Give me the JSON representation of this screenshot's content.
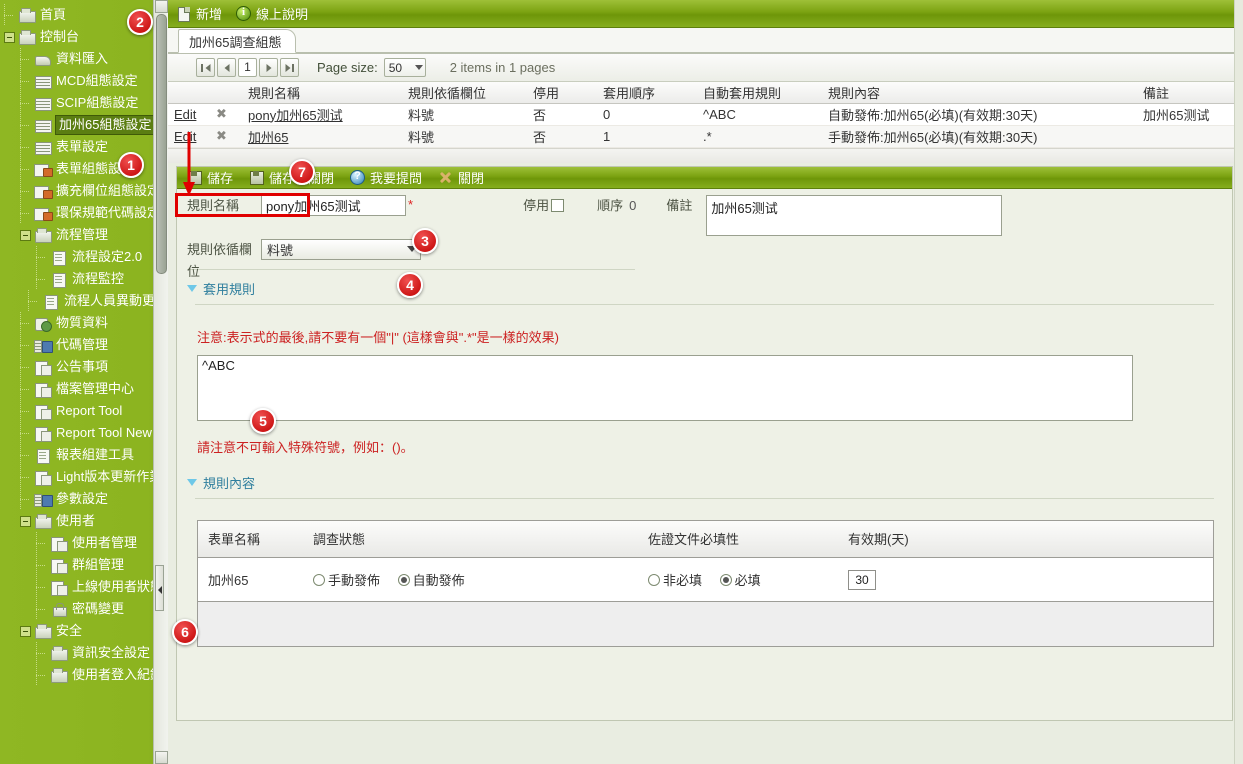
{
  "sidebar": {
    "items": [
      {
        "label": "首頁",
        "level": 0,
        "icon": "folder-icon",
        "expander": false,
        "selected": false
      },
      {
        "label": "控制台",
        "level": 0,
        "icon": "folder-icon",
        "expander": true,
        "selected": false
      },
      {
        "label": "資料匯入",
        "level": 1,
        "icon": "import-icon",
        "expander": false,
        "selected": false
      },
      {
        "label": "MCD組態設定",
        "level": 1,
        "icon": "grid-icon",
        "expander": false,
        "selected": false
      },
      {
        "label": "SCIP組態設定",
        "level": 1,
        "icon": "grid-icon",
        "expander": false,
        "selected": false
      },
      {
        "label": "加州65組態設定",
        "level": 1,
        "icon": "grid-icon",
        "expander": false,
        "selected": true
      },
      {
        "label": "表單設定",
        "level": 1,
        "icon": "grid-icon",
        "expander": false,
        "selected": false
      },
      {
        "label": "表單組態設定",
        "level": 1,
        "icon": "gridp-icon",
        "expander": false,
        "selected": false
      },
      {
        "label": "擴充欄位組態設定",
        "level": 1,
        "icon": "gridp-icon",
        "expander": false,
        "selected": false
      },
      {
        "label": "環保規範代碼設定",
        "level": 1,
        "icon": "gridp-icon",
        "expander": false,
        "selected": false
      },
      {
        "label": "流程管理",
        "level": 1,
        "icon": "folder-icon",
        "expander": true,
        "selected": false
      },
      {
        "label": "流程設定2.0",
        "level": 2,
        "icon": "doc-icon",
        "expander": false,
        "selected": false
      },
      {
        "label": "流程監控",
        "level": 2,
        "icon": "doc-icon",
        "expander": false,
        "selected": false
      },
      {
        "label": "流程人員異動更新",
        "level": 2,
        "icon": "doc-icon",
        "expander": false,
        "selected": false
      },
      {
        "label": "物質資料",
        "level": 1,
        "icon": "material-icon",
        "expander": false,
        "selected": false
      },
      {
        "label": "代碼管理",
        "level": 1,
        "icon": "code-icon",
        "expander": false,
        "selected": false
      },
      {
        "label": "公告事項",
        "level": 1,
        "icon": "page-icon",
        "expander": false,
        "selected": false
      },
      {
        "label": "檔案管理中心",
        "level": 1,
        "icon": "page-icon",
        "expander": false,
        "selected": false
      },
      {
        "label": "Report Tool",
        "level": 1,
        "icon": "page-icon",
        "expander": false,
        "selected": false
      },
      {
        "label": "Report Tool New",
        "level": 1,
        "icon": "page-icon",
        "expander": false,
        "selected": false
      },
      {
        "label": "報表組建工具",
        "level": 1,
        "icon": "doc-icon",
        "expander": false,
        "selected": false
      },
      {
        "label": "Light版本更新作業",
        "level": 1,
        "icon": "page-icon",
        "expander": false,
        "selected": false
      },
      {
        "label": "參數設定",
        "level": 1,
        "icon": "code-icon",
        "expander": false,
        "selected": false
      },
      {
        "label": "使用者",
        "level": 1,
        "icon": "folder-icon",
        "expander": true,
        "selected": false
      },
      {
        "label": "使用者管理",
        "level": 2,
        "icon": "page-icon",
        "expander": false,
        "selected": false
      },
      {
        "label": "群組管理",
        "level": 2,
        "icon": "page-icon",
        "expander": false,
        "selected": false
      },
      {
        "label": "上線使用者狀態",
        "level": 2,
        "icon": "page-icon",
        "expander": false,
        "selected": false
      },
      {
        "label": "密碼變更",
        "level": 2,
        "icon": "lock-icon",
        "expander": false,
        "selected": false
      },
      {
        "label": "安全",
        "level": 1,
        "icon": "folder-icon",
        "expander": true,
        "selected": false
      },
      {
        "label": "資訊安全設定",
        "level": 2,
        "icon": "folder-icon",
        "expander": false,
        "selected": false
      },
      {
        "label": "使用者登入紀錄",
        "level": 2,
        "icon": "folder-icon",
        "expander": false,
        "selected": false
      }
    ]
  },
  "topbar": {
    "new_label": "新增",
    "help_label": "線上說明"
  },
  "tab": {
    "label": "加州65調查組態"
  },
  "pager": {
    "page_number": "1",
    "page_size_label": "Page size:",
    "page_size_value": "50",
    "items_text": "2 items in 1 pages"
  },
  "grid": {
    "columns": [
      "",
      "",
      "規則名稱",
      "規則依循欄位",
      "停用",
      "套用順序",
      "自動套用規則",
      "規則內容",
      "備註"
    ],
    "edit_label": "Edit",
    "delete_glyph": "✖",
    "rows": [
      {
        "edit": "Edit",
        "name": "pony加州65测试",
        "field": "料號",
        "disabled": "否",
        "order": "0",
        "auto_rule": "^ABC",
        "content": "自動發佈:加州65(必填)(有效期:30天)",
        "remark": "加州65测试"
      },
      {
        "edit": "Edit",
        "name": "加州65",
        "field": "料號",
        "disabled": "否",
        "order": "1",
        "auto_rule": ".*",
        "content": "手動發佈:加州65(必填)(有效期:30天)",
        "remark": ""
      }
    ]
  },
  "form": {
    "toolbar": {
      "save_label": "儲存",
      "save_close_label": "儲存後關閉",
      "ask_label": "我要提問",
      "close_label": "關閉"
    },
    "rule_name_label": "規則名稱",
    "rule_name_value": "pony加州65测试",
    "required_mark": "*",
    "disable_label": "停用",
    "order_label": "順序",
    "order_value": "0",
    "remark_label": "備註",
    "remark_value": "加州65测试",
    "rule_field_label": "規則依循欄位",
    "rule_field_value": "料號",
    "apply_rule_section": "套用規則",
    "apply_rule_warning": "注意:表示式的最後,請不要有一個\"|\" (這樣會與\".*\"是一樣的效果)",
    "apply_rule_value": "^ABC",
    "apply_rule_note": "請注意不可輸入特殊符號，例如：()。",
    "rule_content_section": "規則內容"
  },
  "inner_table": {
    "columns": [
      "表單名稱",
      "調查狀態",
      "佐證文件必填性",
      "有效期(天)"
    ],
    "rows": [
      {
        "form_name": "加州65",
        "status_options": [
          {
            "label": "手動發佈",
            "selected": false
          },
          {
            "label": "自動發佈",
            "selected": true
          }
        ],
        "doc_options": [
          {
            "label": "非必填",
            "selected": false
          },
          {
            "label": "必填",
            "selected": true
          }
        ],
        "valid_days": "30"
      }
    ]
  },
  "callouts": [
    {
      "n": "1"
    },
    {
      "n": "2"
    },
    {
      "n": "3"
    },
    {
      "n": "4"
    },
    {
      "n": "5"
    },
    {
      "n": "6"
    },
    {
      "n": "7"
    }
  ],
  "colors": {
    "sidebar_green": "#8cb420",
    "toolbar_green": "#7ba211",
    "panel_bg": "#eef1e6",
    "warning_red": "#cc2222",
    "callout_red": "#c00000",
    "section_blue": "#2f7f9e"
  }
}
